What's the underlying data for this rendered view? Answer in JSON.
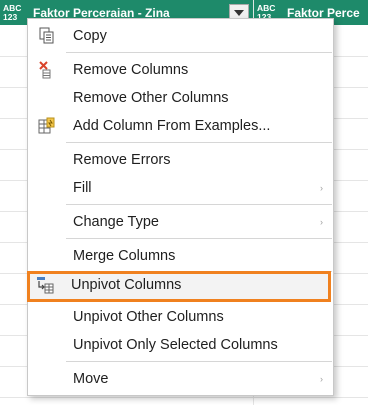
{
  "columns": [
    {
      "type_top": "ABC",
      "type_bottom": "123",
      "title": "Faktor Perceraian - Zina"
    },
    {
      "type_top": "ABC",
      "type_bottom": "123",
      "title": "Faktor Perce"
    }
  ],
  "menu": {
    "copy": "Copy",
    "remove_columns": "Remove Columns",
    "remove_other_columns": "Remove Other Columns",
    "add_column_from_examples": "Add Column From Examples...",
    "remove_errors": "Remove Errors",
    "fill": "Fill",
    "change_type": "Change Type",
    "merge_columns": "Merge Columns",
    "unpivot_columns": "Unpivot Columns",
    "unpivot_other_columns": "Unpivot Other Columns",
    "unpivot_only_selected_columns": "Unpivot Only Selected Columns",
    "move": "Move",
    "submenu_arrow": "›"
  },
  "highlighted_item": "Unpivot Columns",
  "colors": {
    "header": "#1e8a6a",
    "highlight_border": "#f0811f"
  }
}
